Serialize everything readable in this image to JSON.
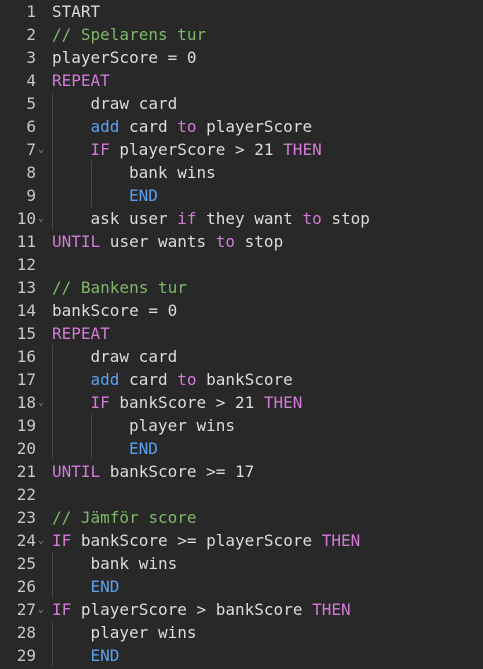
{
  "editor": {
    "lines": [
      {
        "n": "1",
        "fold": "",
        "indent": 0,
        "tokens": [
          {
            "t": "START",
            "c": "plain"
          }
        ]
      },
      {
        "n": "2",
        "fold": "",
        "indent": 0,
        "tokens": [
          {
            "t": "// Spelarens tur",
            "c": "comment"
          }
        ]
      },
      {
        "n": "3",
        "fold": "",
        "indent": 0,
        "tokens": [
          {
            "t": "playerScore = 0",
            "c": "plain"
          }
        ]
      },
      {
        "n": "4",
        "fold": "",
        "indent": 0,
        "tokens": [
          {
            "t": "REPEAT",
            "c": "kw"
          }
        ]
      },
      {
        "n": "5",
        "fold": "",
        "indent": 1,
        "tokens": [
          {
            "t": "draw card",
            "c": "plain"
          }
        ]
      },
      {
        "n": "6",
        "fold": "",
        "indent": 1,
        "tokens": [
          {
            "t": "add",
            "c": "blue"
          },
          {
            "t": " card ",
            "c": "plain"
          },
          {
            "t": "to",
            "c": "kw"
          },
          {
            "t": " playerScore",
            "c": "plain"
          }
        ]
      },
      {
        "n": "7",
        "fold": "⌄",
        "indent": 1,
        "tokens": [
          {
            "t": "IF",
            "c": "kw"
          },
          {
            "t": " playerScore > 21 ",
            "c": "plain"
          },
          {
            "t": "THEN",
            "c": "kw"
          }
        ]
      },
      {
        "n": "8",
        "fold": "",
        "indent": 2,
        "tokens": [
          {
            "t": "bank wins",
            "c": "plain"
          }
        ]
      },
      {
        "n": "9",
        "fold": "",
        "indent": 2,
        "tokens": [
          {
            "t": "END",
            "c": "blue"
          }
        ]
      },
      {
        "n": "10",
        "fold": "⌄",
        "indent": 1,
        "tokens": [
          {
            "t": "ask user ",
            "c": "plain"
          },
          {
            "t": "if",
            "c": "kw"
          },
          {
            "t": " they want ",
            "c": "plain"
          },
          {
            "t": "to",
            "c": "kw"
          },
          {
            "t": " stop",
            "c": "plain"
          }
        ]
      },
      {
        "n": "11",
        "fold": "",
        "indent": 0,
        "tokens": [
          {
            "t": "UNTIL",
            "c": "kw"
          },
          {
            "t": " user wants ",
            "c": "plain"
          },
          {
            "t": "to",
            "c": "kw"
          },
          {
            "t": " stop",
            "c": "plain"
          }
        ]
      },
      {
        "n": "12",
        "fold": "",
        "indent": 0,
        "tokens": []
      },
      {
        "n": "13",
        "fold": "",
        "indent": 0,
        "tokens": [
          {
            "t": "// Bankens tur",
            "c": "comment"
          }
        ]
      },
      {
        "n": "14",
        "fold": "",
        "indent": 0,
        "tokens": [
          {
            "t": "bankScore = 0",
            "c": "plain"
          }
        ]
      },
      {
        "n": "15",
        "fold": "",
        "indent": 0,
        "tokens": [
          {
            "t": "REPEAT",
            "c": "kw"
          }
        ]
      },
      {
        "n": "16",
        "fold": "",
        "indent": 1,
        "tokens": [
          {
            "t": "draw card",
            "c": "plain"
          }
        ]
      },
      {
        "n": "17",
        "fold": "",
        "indent": 1,
        "tokens": [
          {
            "t": "add",
            "c": "blue"
          },
          {
            "t": " card ",
            "c": "plain"
          },
          {
            "t": "to",
            "c": "kw"
          },
          {
            "t": " bankScore",
            "c": "plain"
          }
        ]
      },
      {
        "n": "18",
        "fold": "⌄",
        "indent": 1,
        "tokens": [
          {
            "t": "IF",
            "c": "kw"
          },
          {
            "t": " bankScore > 21 ",
            "c": "plain"
          },
          {
            "t": "THEN",
            "c": "kw"
          }
        ]
      },
      {
        "n": "19",
        "fold": "",
        "indent": 2,
        "tokens": [
          {
            "t": "player wins",
            "c": "plain"
          }
        ]
      },
      {
        "n": "20",
        "fold": "",
        "indent": 2,
        "tokens": [
          {
            "t": "END",
            "c": "blue"
          }
        ]
      },
      {
        "n": "21",
        "fold": "",
        "indent": 0,
        "tokens": [
          {
            "t": "UNTIL",
            "c": "kw"
          },
          {
            "t": " bankScore >= 17",
            "c": "plain"
          }
        ]
      },
      {
        "n": "22",
        "fold": "",
        "indent": 0,
        "tokens": []
      },
      {
        "n": "23",
        "fold": "",
        "indent": 0,
        "tokens": [
          {
            "t": "// Jämför score",
            "c": "comment"
          }
        ]
      },
      {
        "n": "24",
        "fold": "⌄",
        "indent": 0,
        "tokens": [
          {
            "t": "IF",
            "c": "kw"
          },
          {
            "t": " bankScore >= playerScore ",
            "c": "plain"
          },
          {
            "t": "THEN",
            "c": "kw"
          }
        ]
      },
      {
        "n": "25",
        "fold": "",
        "indent": 1,
        "tokens": [
          {
            "t": "bank wins",
            "c": "plain"
          }
        ]
      },
      {
        "n": "26",
        "fold": "",
        "indent": 1,
        "tokens": [
          {
            "t": "END",
            "c": "blue"
          }
        ]
      },
      {
        "n": "27",
        "fold": "⌄",
        "indent": 0,
        "tokens": [
          {
            "t": "IF",
            "c": "kw"
          },
          {
            "t": " playerScore > bankScore ",
            "c": "plain"
          },
          {
            "t": "THEN",
            "c": "kw"
          }
        ]
      },
      {
        "n": "28",
        "fold": "",
        "indent": 1,
        "tokens": [
          {
            "t": "player wins",
            "c": "plain"
          }
        ]
      },
      {
        "n": "29",
        "fold": "",
        "indent": 1,
        "tokens": [
          {
            "t": "END",
            "c": "blue"
          }
        ]
      }
    ]
  },
  "colors": {
    "background": "#282828",
    "text": "#dcdcdc",
    "keyword": "#d17bd6",
    "blue": "#5aa0f0",
    "comment": "#7fb86a",
    "gutter": "#c8c8c8"
  }
}
